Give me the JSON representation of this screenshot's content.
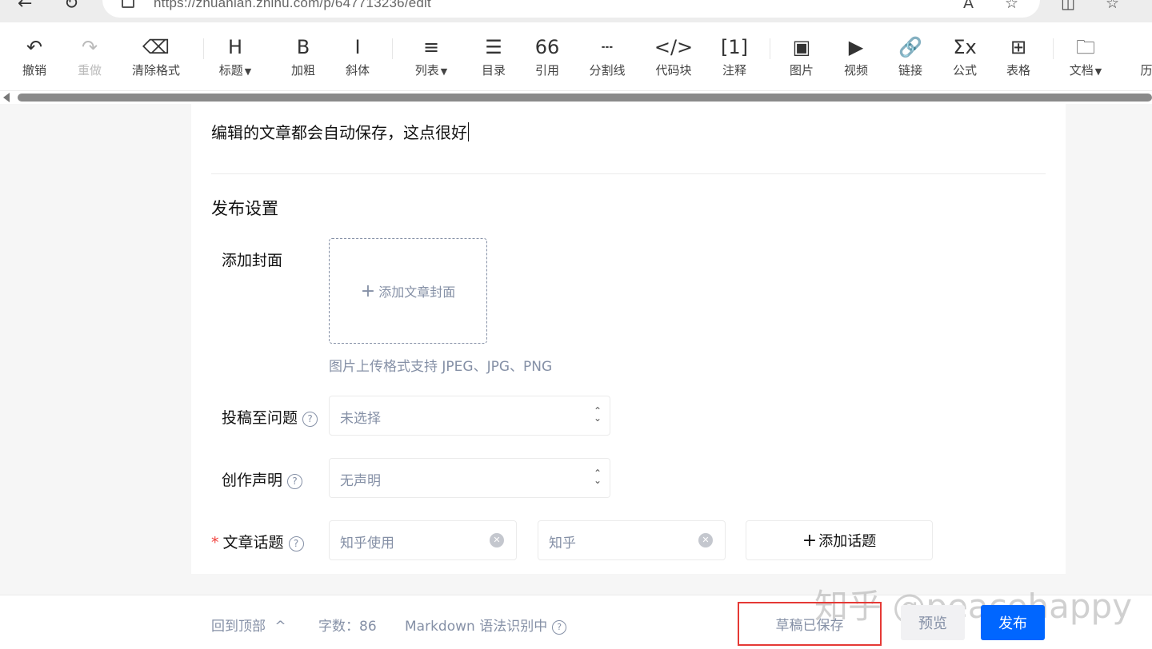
{
  "browser": {
    "url": "https://zhuanlan.zhihu.com/p/647713236/edit"
  },
  "toolbar": {
    "items": [
      {
        "icon": "undo-icon",
        "glyph": "↶",
        "label": "撤销",
        "disabled": false
      },
      {
        "icon": "redo-icon",
        "glyph": "↷",
        "label": "重做",
        "disabled": true
      },
      {
        "icon": "eraser-icon",
        "glyph": "⌫",
        "label": "清除格式",
        "disabled": false
      },
      {
        "icon": "heading-icon",
        "glyph": "H",
        "label": "标题",
        "dropdown": true
      },
      {
        "icon": "bold-icon",
        "glyph": "B",
        "label": "加粗"
      },
      {
        "icon": "italic-icon",
        "glyph": "I",
        "label": "斜体"
      },
      {
        "icon": "list-icon",
        "glyph": "≡",
        "label": "列表",
        "dropdown": true
      },
      {
        "icon": "toc-icon",
        "glyph": "☰",
        "label": "目录"
      },
      {
        "icon": "quote-icon",
        "glyph": "66",
        "label": "引用"
      },
      {
        "icon": "divider-icon",
        "glyph": "┄",
        "label": "分割线"
      },
      {
        "icon": "code-icon",
        "glyph": "</>",
        "label": "代码块"
      },
      {
        "icon": "footnote-icon",
        "glyph": "[1]",
        "label": "注释"
      },
      {
        "icon": "image-icon",
        "glyph": "▣",
        "label": "图片"
      },
      {
        "icon": "video-icon",
        "glyph": "▶",
        "label": "视频"
      },
      {
        "icon": "link-icon",
        "glyph": "🔗",
        "label": "链接"
      },
      {
        "icon": "formula-icon",
        "glyph": "Σx",
        "label": "公式"
      },
      {
        "icon": "table-icon",
        "glyph": "⊞",
        "label": "表格"
      },
      {
        "icon": "doc-icon",
        "glyph": "🗀",
        "label": "文档",
        "dropdown": true
      },
      {
        "icon": "history-icon",
        "glyph": "",
        "label": "历"
      }
    ]
  },
  "editor": {
    "body_text": "编辑的文章都会自动保存，这点很好"
  },
  "publish": {
    "title": "发布设置",
    "cover_label": "添加封面",
    "cover_button": "添加文章封面",
    "cover_hint": "图片上传格式支持 JPEG、JPG、PNG",
    "question_label": "投稿至问题",
    "question_value": "未选择",
    "statement_label": "创作声明",
    "statement_value": "无声明",
    "topic_label": "文章话题",
    "topics": [
      "知乎使用",
      "知乎"
    ],
    "add_topic": "添加话题"
  },
  "footer": {
    "back_to_top": "回到顶部",
    "word_count": "字数：86",
    "markdown": "Markdown 语法识别中",
    "draft_status": "草稿已保存",
    "preview": "预览",
    "publish": "发布",
    "watermark": "知乎 @peacehappy"
  },
  "colors": {
    "primary": "#0066ff",
    "muted": "#8590a6",
    "highlight": "#e53935"
  }
}
